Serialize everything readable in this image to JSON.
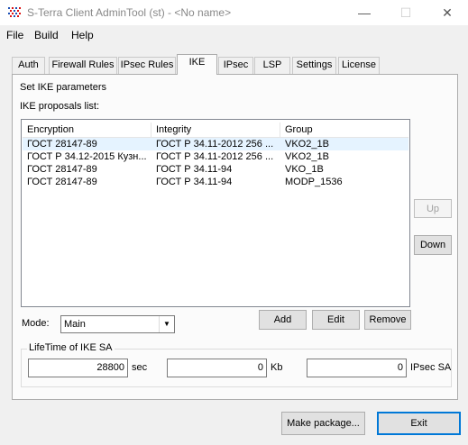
{
  "window": {
    "title": "S-Terra Client AdminTool (st) - <No name>",
    "controls": {
      "minimize": "—",
      "maximize": "☐",
      "close": "✕"
    }
  },
  "menu": [
    "File",
    "Build",
    "Help"
  ],
  "tabs": [
    {
      "label": "Auth",
      "active": false
    },
    {
      "label": "Firewall Rules",
      "active": false
    },
    {
      "label": "IPsec Rules",
      "active": false
    },
    {
      "label": "IKE",
      "active": true
    },
    {
      "label": "IPsec",
      "active": false
    },
    {
      "label": "LSP",
      "active": false
    },
    {
      "label": "Settings",
      "active": false
    },
    {
      "label": "License",
      "active": false
    }
  ],
  "ike": {
    "heading": "Set IKE parameters",
    "list_label": "IKE proposals list:",
    "columns": [
      "Encryption",
      "Integrity",
      "Group"
    ],
    "rows": [
      {
        "encryption": "ГОСТ 28147-89",
        "integrity": "ГОСТ Р 34.11-2012 256 ...",
        "group": "VKO2_1B",
        "selected": true
      },
      {
        "encryption": "ГОСТ Р 34.12-2015 Кузн...",
        "integrity": "ГОСТ Р 34.11-2012 256 ...",
        "group": "VKO2_1B",
        "selected": false
      },
      {
        "encryption": "ГОСТ 28147-89",
        "integrity": "ГОСТ Р 34.11-94",
        "group": "VKO_1B",
        "selected": false
      },
      {
        "encryption": "ГОСТ 28147-89",
        "integrity": "ГОСТ Р 34.11-94",
        "group": "MODP_1536",
        "selected": false
      }
    ],
    "up_label": "Up",
    "down_label": "Down",
    "mode_label": "Mode:",
    "mode_value": "Main",
    "add_label": "Add",
    "edit_label": "Edit",
    "remove_label": "Remove",
    "lifetime": {
      "title": "LifeTime of IKE SA",
      "sec_value": "28800",
      "sec_unit": "sec",
      "kb_value": "0",
      "kb_unit": "Kb",
      "ipsec_value": "0",
      "ipsec_unit": "IPsec SA"
    }
  },
  "footer": {
    "make_package_label": "Make package...",
    "exit_label": "Exit"
  }
}
